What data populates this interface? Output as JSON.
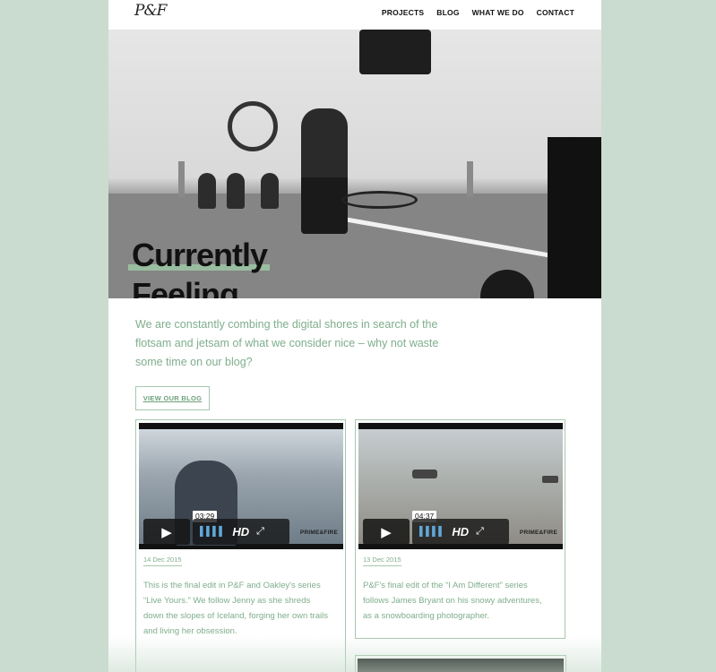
{
  "header": {
    "logo": "P&F",
    "nav": [
      "PROJECTS",
      "BLOG",
      "WHAT WE DO",
      "CONTACT"
    ]
  },
  "hero": {
    "title_line1": "Currently",
    "title_line2": "Feeling"
  },
  "intro": {
    "text": "We are constantly combing the digital shores in search of the flotsam and jetsam of what we consider nice – why not waste some time on our blog?",
    "button": "VIEW OUR BLOG"
  },
  "cards": [
    {
      "duration": "03:29",
      "hd": "HD",
      "brand": "PRIME&FIRE",
      "date": "14 Dec 2015",
      "description": "This is the final edit in P&F and Oakley's series “Live Yours.” We follow Jenny as she shreds down the slopes of Iceland, forging her own trails and living her obsession."
    },
    {
      "duration": "04:37",
      "hd": "HD",
      "brand": "PRIME&FIRE",
      "date": "13 Dec 2015",
      "description": "P&F's final edit of the “I Am Different” series follows James Bryant on his snowy adventures, as a snowboarding photographer."
    }
  ],
  "colors": {
    "background": "#c9dccf",
    "accent": "#7fae8c",
    "border": "#a7c7af"
  }
}
